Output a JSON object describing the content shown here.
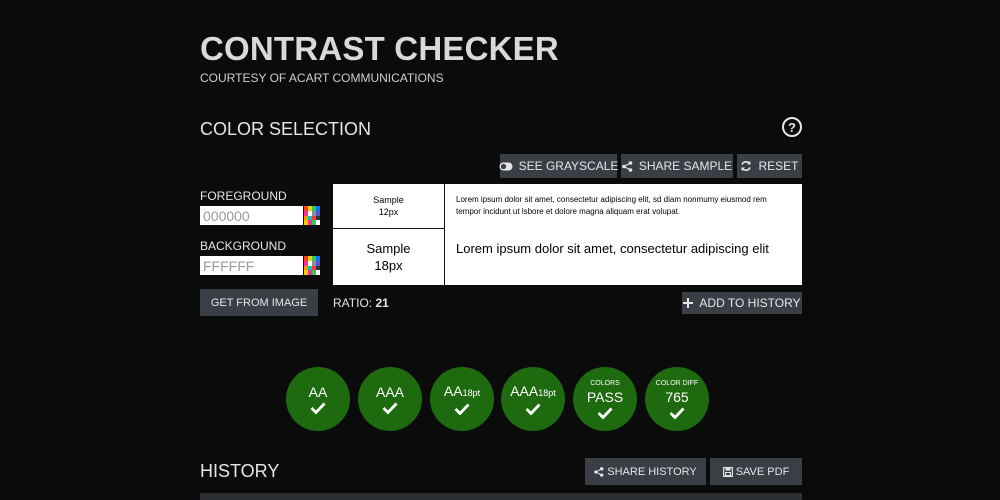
{
  "header": {
    "title": "CONTRAST CHECKER",
    "subtitle": "COURTESY OF ACART COMMUNICATIONS"
  },
  "color_selection": {
    "title": "COLOR SELECTION",
    "help_symbol": "?",
    "buttons": {
      "grayscale": "SEE GRAYSCALE",
      "share_sample": "SHARE SAMPLE",
      "reset": "RESET",
      "get_from_image": "GET FROM IMAGE",
      "add_to_history": "ADD TO HISTORY"
    },
    "foreground": {
      "label": "FOREGROUND",
      "value": "000000"
    },
    "background": {
      "label": "BACKGROUND",
      "value": "FFFFFF"
    },
    "preview": {
      "small_label": "Sample",
      "small_size": "12px",
      "large_label": "Sample",
      "large_size": "18px",
      "small_text": "Lorem ipsum dolor sit amet, consectetur adipiscing elit, sd diam nonmumy eiusmod rem tempor incidunt ut lsbore et dolore magna aliquam erat volupat.",
      "large_text": "Lorem ipsum dolor sit amet, consectetur adipiscing elit"
    },
    "ratio_label": "RATIO:",
    "ratio_value": "21"
  },
  "results": [
    {
      "small": "",
      "main": "AA",
      "sub": ""
    },
    {
      "small": "",
      "main": "AAA",
      "sub": ""
    },
    {
      "small": "",
      "main": "AA",
      "sub": "18pt"
    },
    {
      "small": "",
      "main": "AAA",
      "sub": "18pt"
    },
    {
      "small": "COLORS",
      "main": "PASS",
      "sub": ""
    },
    {
      "small": "COLOR DIFF",
      "main": "765",
      "sub": ""
    }
  ],
  "history": {
    "title": "HISTORY",
    "share_button": "SHARE HISTORY",
    "save_button": "SAVE PDF"
  },
  "colors": {
    "background": "#0b0b0b",
    "button": "#3a3f46",
    "pass_badge": "#1e6a0e"
  }
}
